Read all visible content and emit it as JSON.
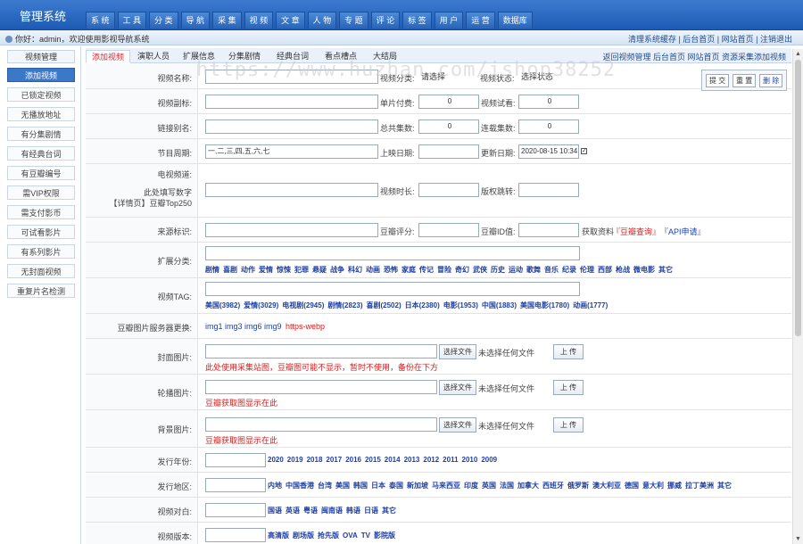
{
  "app": {
    "title": "管理系统"
  },
  "topnav": [
    "系 统",
    "工 具",
    "分 类",
    "导 航",
    "采 集",
    "视 频",
    "文 章",
    "人 物",
    "专 题",
    "评 论",
    "标 签",
    "用 户",
    "运 营",
    "数据库"
  ],
  "subbar": {
    "greeting": "你好：admin，欢迎使用影视导航系统",
    "links": "清理系统缓存 | 后台首页 | 网站首页 | 注销退出"
  },
  "sidebar": {
    "head": "视频管理",
    "items": [
      "添加视频",
      "已锁定视频",
      "无播放地址",
      "有分集剧情",
      "有经典台词",
      "有豆瓣编号",
      "需VIP权限",
      "需支付影币",
      "可试看影片",
      "有系列影片",
      "无封面视频",
      "重复片名检测"
    ]
  },
  "tabs": [
    "添加视频",
    "演职人员",
    "扩展信息",
    "分集剧情",
    "经典台词",
    "看点槽点",
    "大结局"
  ],
  "tablinks": "返回视频管理  后台首页  网站首页  资源采集添加视频",
  "actions": {
    "submit": "提 交",
    "reset": "重 置",
    "delete": "删 除"
  },
  "watermark": "https://www.huzhan.com/ishop38252",
  "form": {
    "name_label": "视频名称:",
    "cat_label": "视频分类:",
    "cat_value": "请选择",
    "status_label": "视频状态:",
    "status_value": "选择状态",
    "subtitle_label": "视频副标:",
    "single_pay_label": "单片付费:",
    "single_pay_value": "0",
    "trial_label": "视频试看:",
    "trial_value": "0",
    "alias_label": "链接别名:",
    "total_label": "总共集数:",
    "total_value": "0",
    "serial_label": "连载集数:",
    "serial_value": "0",
    "period_label": "节目周期:",
    "period_value": "一,二,三,四,五,六,七",
    "release_label": "上映日期:",
    "update_label": "更新日期:",
    "update_value": "2020-08-15 10:34",
    "tv_label": "电视频道:",
    "tv_hint1": "此处填写数字",
    "tv_hint2": "【详情页】豆瓣Top250",
    "duration_label": "视频时长:",
    "jump_label": "版权跳转:",
    "source_label": "来源标识:",
    "douban_score_label": "豆瓣评分:",
    "douban_id_label": "豆瓣ID值:",
    "fetch_text": "获取资料",
    "douban_query": "『豆瓣查询』",
    "api_apply": "『API申请』",
    "ext_label": "扩展分类:",
    "ext_tags": [
      "剧情",
      "喜剧",
      "动作",
      "爱情",
      "惊悚",
      "犯罪",
      "悬疑",
      "战争",
      "科幻",
      "动画",
      "恐怖",
      "家庭",
      "传记",
      "冒险",
      "奇幻",
      "武侠",
      "历史",
      "运动",
      "歌舞",
      "音乐",
      "纪录",
      "伦理",
      "西部",
      "枪战",
      "微电影",
      "其它"
    ],
    "tag_label": "视频TAG:",
    "tag_list": [
      "美国(3982)",
      "爱情(3029)",
      "电视剧(2945)",
      "剧情(2823)",
      "喜剧(2502)",
      "日本(2380)",
      "电影(1953)",
      "中国(1883)",
      "美国电影(1780)",
      "动画(1777)"
    ],
    "img_server_label": "豆瓣图片服务器更换:",
    "img_servers": "img1 img3 img6 img9",
    "img_https": "https-webp",
    "cover_label": "封面图片:",
    "cover_note": "此处使用采集站图，豆瓣图可能不显示，暂时不使用，备份在下方",
    "carousel_label": "轮播图片:",
    "carousel_note": "豆瓣获取图显示在此",
    "bg_label": "背景图片:",
    "bg_note": "豆瓣获取图显示在此",
    "choose_file": "选择文件",
    "no_file": "未选择任何文件",
    "upload": "上 传",
    "year_label": "发行年份:",
    "years": [
      "2020",
      "2019",
      "2018",
      "2017",
      "2016",
      "2015",
      "2014",
      "2013",
      "2012",
      "2011",
      "2010",
      "2009"
    ],
    "area_label": "发行地区:",
    "areas": [
      "内地",
      "中国香港",
      "台湾",
      "美国",
      "韩国",
      "日本",
      "泰国",
      "新加坡",
      "马来西亚",
      "印度",
      "英国",
      "法国",
      "加拿大",
      "西班牙",
      "俄罗斯",
      "澳大利亚",
      "德国",
      "意大利",
      "挪威",
      "拉丁美洲",
      "其它"
    ],
    "lang_label": "视频对白:",
    "langs": [
      "国语",
      "英语",
      "粤语",
      "闽南语",
      "韩语",
      "日语",
      "其它"
    ],
    "version_label": "视频版本:",
    "versions": [
      "高清版",
      "剧场版",
      "抢先版",
      "OVA",
      "TV",
      "影院版"
    ]
  }
}
